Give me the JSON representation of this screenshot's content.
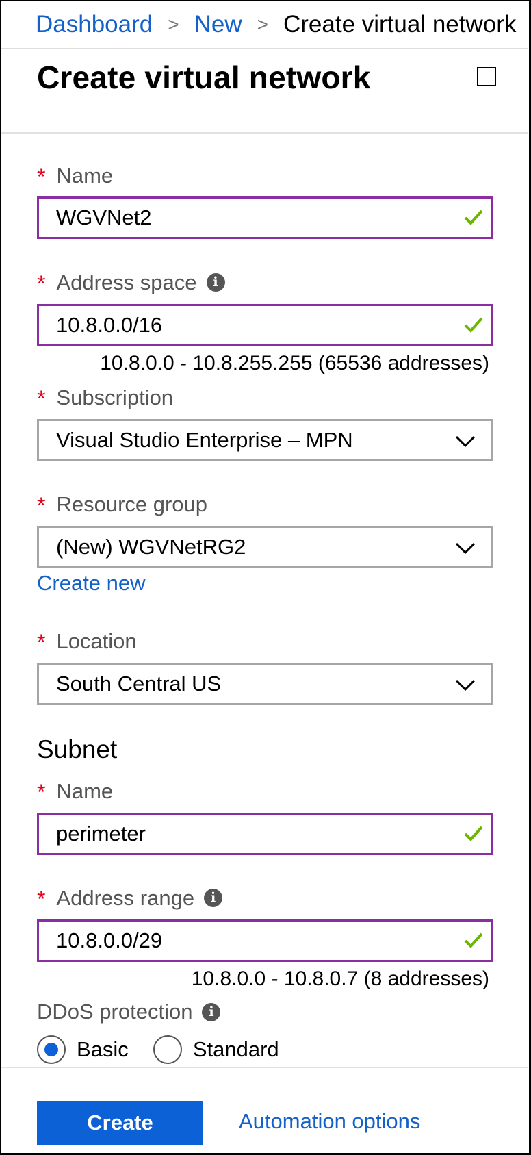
{
  "breadcrumb": {
    "items": [
      "Dashboard",
      "New"
    ],
    "current": "Create virtual network"
  },
  "title": "Create virtual network",
  "form": {
    "name": {
      "label": "Name",
      "value": "WGVNet2",
      "valid": true
    },
    "address_space": {
      "label": "Address space",
      "value": "10.8.0.0/16",
      "hint": "10.8.0.0 - 10.8.255.255 (65536 addresses)",
      "valid": true
    },
    "subscription": {
      "label": "Subscription",
      "value": "Visual Studio Enterprise – MPN"
    },
    "resource_group": {
      "label": "Resource group",
      "value": "(New) WGVNetRG2",
      "create_new": "Create new"
    },
    "location": {
      "label": "Location",
      "value": "South Central US"
    }
  },
  "subnet": {
    "heading": "Subnet",
    "name": {
      "label": "Name",
      "value": "perimeter",
      "valid": true
    },
    "address_range": {
      "label": "Address range",
      "value": "10.8.0.0/29",
      "hint": "10.8.0.0 - 10.8.0.7 (8 addresses)",
      "valid": true
    }
  },
  "ddos": {
    "label": "DDoS protection",
    "options": [
      "Basic",
      "Standard"
    ],
    "selected": "Basic"
  },
  "footer": {
    "create_label": "Create",
    "automation_label": "Automation options"
  },
  "colors": {
    "link": "#1461c9",
    "required": "#e3001b",
    "valid_border": "#8a2ea1",
    "check": "#6bb700",
    "primary": "#0c61d6"
  },
  "icons": {
    "required": "*",
    "info": "i"
  }
}
